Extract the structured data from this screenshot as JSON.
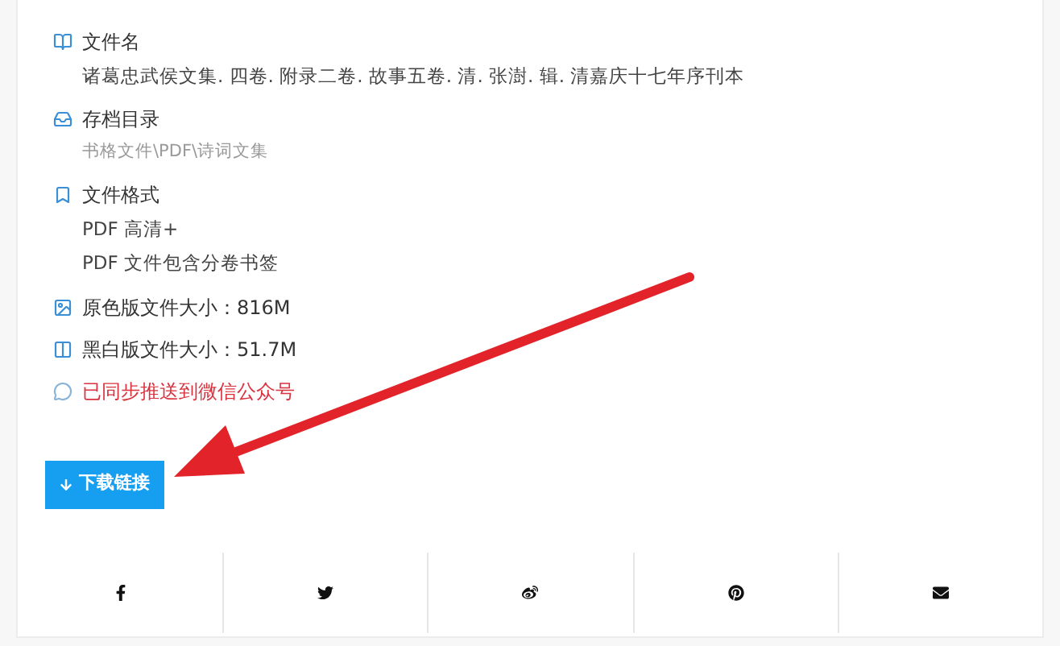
{
  "details": [
    {
      "kind": "block",
      "title": "文件名",
      "lines": [
        "诸葛忠武侯文集. 四卷. 附录二卷. 故事五卷. 清. 张澍. 辑. 清嘉庆十七年序刊本"
      ]
    },
    {
      "kind": "path",
      "title": "存档目录",
      "lines": [
        "书格文件\\PDF\\诗词文集"
      ]
    },
    {
      "kind": "block",
      "title": "文件格式",
      "lines": [
        "PDF 高清+",
        "PDF 文件包含分卷书签"
      ]
    },
    {
      "kind": "line",
      "text": "原色版文件大小：816M"
    },
    {
      "kind": "line",
      "text": "黑白版文件大小：51.7M"
    },
    {
      "kind": "notice",
      "text": "已同步推送到微信公众号"
    }
  ],
  "download_button": {
    "label": "下载链接"
  }
}
